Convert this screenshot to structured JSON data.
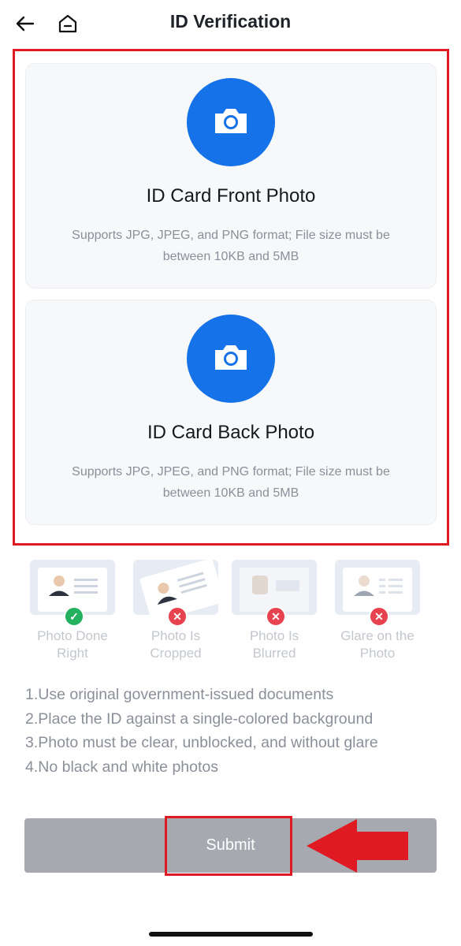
{
  "header": {
    "title": "ID Verification"
  },
  "icons": {
    "back": "arrow-left-icon",
    "home": "home-icon",
    "camera": "camera-icon"
  },
  "upload": {
    "front": {
      "title": "ID Card Front Photo",
      "desc_line1": "Supports JPG, JPEG, and PNG format; File size must be",
      "desc_line2": "between 10KB and 5MB"
    },
    "back": {
      "title": "ID Card Back Photo",
      "desc_line1": "Supports JPG, JPEG, and PNG format; File size must be",
      "desc_line2": "between 10KB and 5MB"
    }
  },
  "examples": [
    {
      "line1": "Photo Done",
      "line2": "Right",
      "status": "ok"
    },
    {
      "line1": "Photo Is",
      "line2": "Cropped",
      "status": "bad"
    },
    {
      "line1": "Photo Is",
      "line2": "Blurred",
      "status": "bad"
    },
    {
      "line1": "Glare on the",
      "line2": "Photo",
      "status": "bad"
    }
  ],
  "tips": [
    "1.Use original government-issued documents",
    "2.Place the ID against a single-colored background",
    "3.Photo must be clear, unblocked, and without glare",
    "4.No black and white photos"
  ],
  "submit": {
    "label": "Submit"
  },
  "colors": {
    "accent": "#1572e8",
    "highlight": "#e01a22",
    "button_disabled": "#a6a9b0",
    "ok": "#23b15f",
    "error": "#e7424f"
  }
}
